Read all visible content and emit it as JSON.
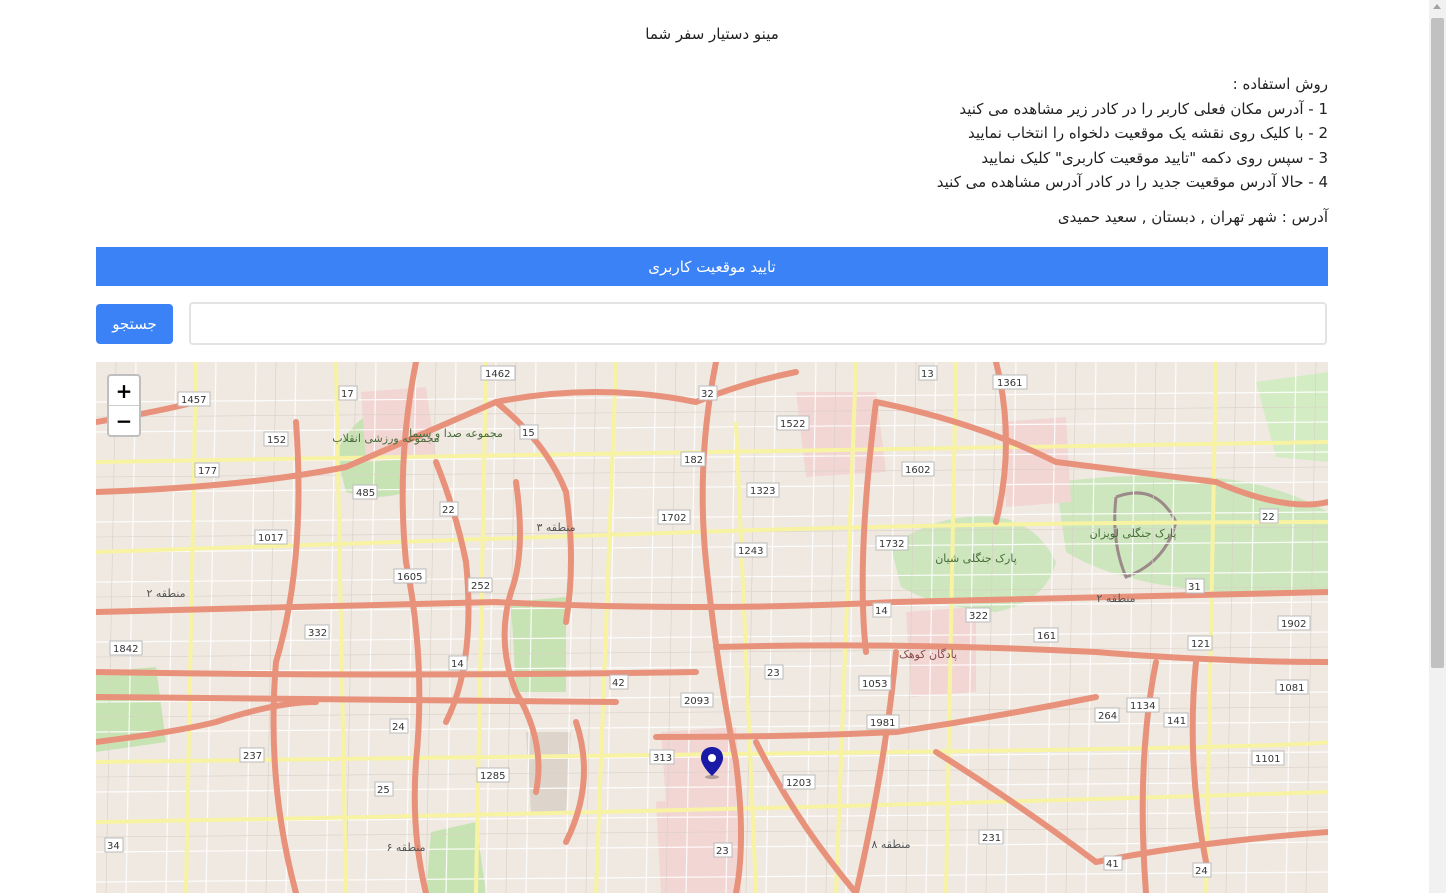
{
  "app": {
    "title": "مینو دستیار سفر شما"
  },
  "instructions": {
    "heading": "روش استفاده :",
    "steps": [
      "1 - آدرس مکان فعلی کاربر را در کادر زیر مشاهده می کنید",
      "2 - با کلیک روی نقشه یک موقعیت دلخواه را انتخاب نمایید",
      "3 - سپس روی دکمه \"تایید موقعیت کاربری\" کلیک نمایید",
      "4 - حالا آدرس موقعیت جدید را در کادر آدرس مشاهده می کنید"
    ]
  },
  "address": {
    "text": "آدرس : شهر تهران , دبستان , سعید حمیدی"
  },
  "confirm": {
    "label": "تایید موقعیت کاربری"
  },
  "search": {
    "button_label": "جستجو",
    "value": "",
    "placeholder": ""
  },
  "map": {
    "zoom_in": "+",
    "zoom_out": "−",
    "district_labels": [
      "منطقه ۳",
      "منطقه ۲",
      "منطقه ۶",
      "منطقه ۸",
      "منطقه ۲"
    ],
    "place_labels": [
      "پارک جنگلی لویزان",
      "پادگان کوهک",
      "مجموعه صدا و سیما",
      "مجموعه ورزشی انقلاب",
      "پارک جنگلی شیان"
    ],
    "road_numbers": [
      "1462",
      "32",
      "13",
      "1361",
      "1457",
      "17",
      "15",
      "1522",
      "152",
      "182",
      "1602",
      "177",
      "485",
      "1323",
      "22",
      "1702",
      "22",
      "1017",
      "1605",
      "1243",
      "1732",
      "252",
      "31",
      "14",
      "322",
      "161",
      "1902",
      "332",
      "121",
      "1842",
      "42",
      "14",
      "23",
      "1053",
      "1081",
      "2093",
      "1134",
      "264",
      "1981",
      "141",
      "24",
      "237",
      "313",
      "1203",
      "1101",
      "1285",
      "25",
      "231",
      "34",
      "23",
      "41",
      "24"
    ],
    "marker_icon": "map-pin-icon"
  },
  "colors": {
    "accent": "#3b82f6",
    "marker": "#1a1aa6"
  }
}
